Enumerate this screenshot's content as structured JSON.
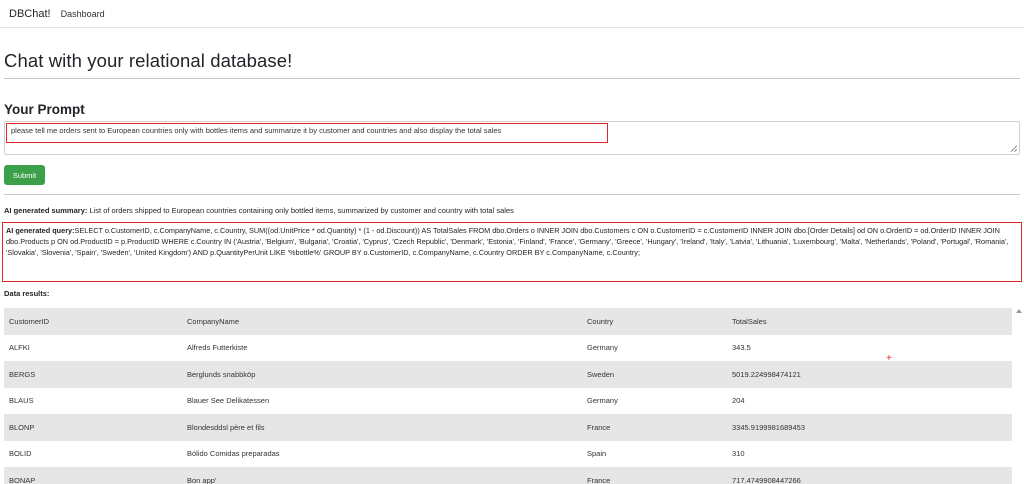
{
  "navbar": {
    "brand": "DBChat!",
    "links": [
      "Dashboard"
    ]
  },
  "page": {
    "title": "Chat with your relational database!"
  },
  "prompt": {
    "heading": "Your Prompt",
    "value": "please tell me orders sent to European countries only with bottles items and summarize it by customer and countries and also display the total sales",
    "submit_label": "Submit"
  },
  "summary": {
    "label": "AI generated summary:",
    "text": " List of orders shipped to European countries containing only bottled items, summarized by customer and country with total sales"
  },
  "query": {
    "label": "AI generated query:",
    "text": "SELECT o.CustomerID, c.CompanyName, c.Country, SUM((od.UnitPrice * od.Quantity) * (1 - od.Discount)) AS TotalSales FROM dbo.Orders o INNER JOIN dbo.Customers c ON o.CustomerID = c.CustomerID INNER JOIN dbo.[Order Details] od ON o.OrderID = od.OrderID INNER JOIN dbo.Products p ON od.ProductID = p.ProductID WHERE c.Country IN ('Austria', 'Belgium', 'Bulgaria', 'Croatia', 'Cyprus', 'Czech Republic', 'Denmark', 'Estonia', 'Finland', 'France', 'Germany', 'Greece', 'Hungary', 'Ireland', 'Italy', 'Latvia', 'Lithuania', 'Luxembourg', 'Malta', 'Netherlands', 'Poland', 'Portugal', 'Romania', 'Slovakia', 'Slovenia', 'Spain', 'Sweden', 'United Kingdom') AND p.QuantityPerUnit LIKE '%bottle%' GROUP BY o.CustomerID, c.CompanyName, c.Country ORDER BY c.CompanyName, c.Country;"
  },
  "results": {
    "label": "Data results:",
    "columns": [
      "CustomerID",
      "CompanyName",
      "Country",
      "TotalSales"
    ],
    "rows": [
      [
        "ALFKI",
        "Alfreds Futterkiste",
        "Germany",
        "343.5"
      ],
      [
        "BERGS",
        "Berglunds snabbköp",
        "Sweden",
        "5019.224998474121"
      ],
      [
        "BLAUS",
        "Blauer See Delikatessen",
        "Germany",
        "204"
      ],
      [
        "BLONP",
        "Blondesddsl père et fils",
        "France",
        "3345.9199981689453"
      ],
      [
        "BOLID",
        "Bólido Comidas preparadas",
        "Spain",
        "310"
      ],
      [
        "BONAP",
        "Bon app'",
        "France",
        "717.4749908447266"
      ]
    ]
  },
  "colors": {
    "submit_green": "#3c9f4a",
    "highlight_red": "#e0262b",
    "stripe_gray": "#e6e6e6"
  }
}
